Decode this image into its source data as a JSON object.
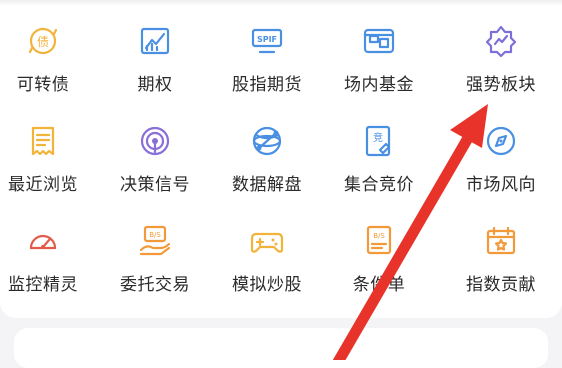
{
  "menu": {
    "items": [
      {
        "label": "可转债",
        "icon": "convertible-bond-icon",
        "color": "#f2b33a"
      },
      {
        "label": "期权",
        "icon": "option-chart-icon",
        "color": "#4a90e2"
      },
      {
        "label": "股指期货",
        "icon": "spif-icon",
        "color": "#4a90e2",
        "icon_text": "SPIF"
      },
      {
        "label": "场内基金",
        "icon": "fund-icon",
        "color": "#4a90e2"
      },
      {
        "label": "强势板块",
        "icon": "strong-sector-icon",
        "color": "#7b6fd8"
      },
      {
        "label": "最近浏览",
        "icon": "recent-browse-icon",
        "color": "#f2b33a"
      },
      {
        "label": "决策信号",
        "icon": "decision-signal-icon",
        "color": "#8a6fd8"
      },
      {
        "label": "数据解盘",
        "icon": "data-globe-icon",
        "color": "#4a90e2"
      },
      {
        "label": "集合竞价",
        "icon": "auction-icon",
        "color": "#4a90e2",
        "icon_text": "竞"
      },
      {
        "label": "市场风向",
        "icon": "compass-icon",
        "color": "#4a90e2"
      },
      {
        "label": "监控精灵",
        "icon": "monitor-gauge-icon",
        "color": "#e25a4a"
      },
      {
        "label": "委托交易",
        "icon": "entrust-trade-icon",
        "color": "#f29a3a",
        "icon_text": "B/S"
      },
      {
        "label": "模拟炒股",
        "icon": "gamepad-icon",
        "color": "#f2b33a"
      },
      {
        "label": "条件单",
        "icon": "condition-order-icon",
        "color": "#f29a3a",
        "icon_text": "B/S"
      },
      {
        "label": "指数贡献",
        "icon": "index-contribution-icon",
        "color": "#f29a3a"
      }
    ]
  },
  "annotation": {
    "icon": "red-arrow-icon",
    "color": "#e8332a"
  }
}
